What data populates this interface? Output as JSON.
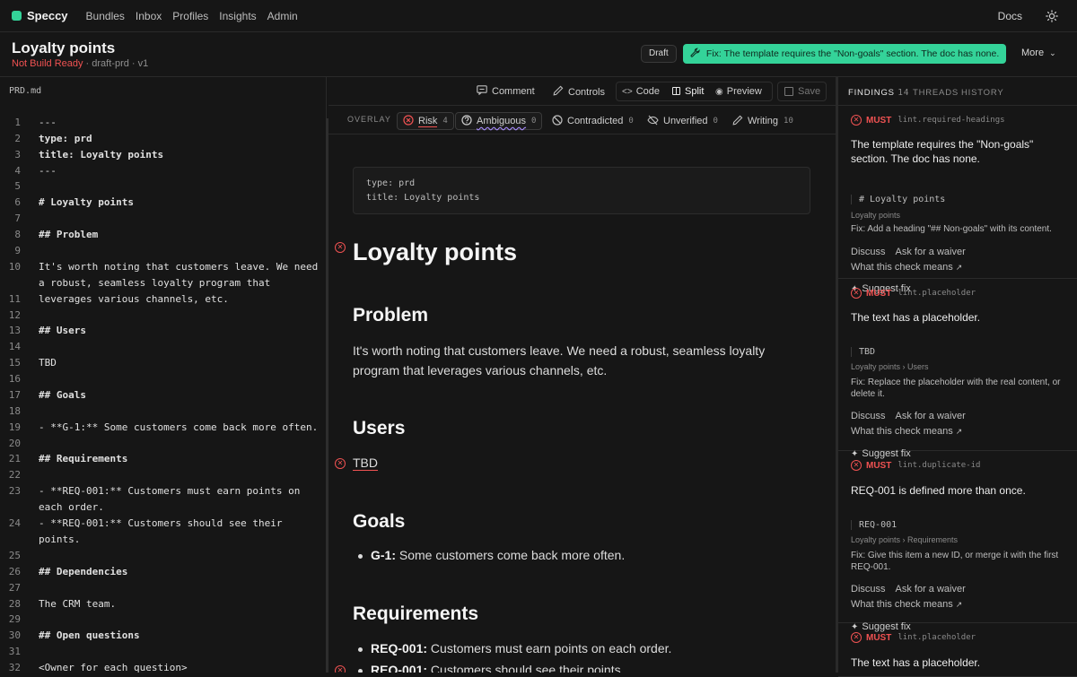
{
  "app": {
    "name": "Speccy"
  },
  "nav": [
    "Bundles",
    "Inbox",
    "Profiles",
    "Insights",
    "Admin"
  ],
  "topbar": {
    "docs": "Docs"
  },
  "doc": {
    "title": "Loyalty points",
    "status": "Not Build Ready",
    "meta": " · draft-prd · v1",
    "badge": "Draft",
    "fix_banner": "Fix: The template requires the \"Non-goals\" section. The doc has none.",
    "more": "More"
  },
  "editor": {
    "file": "PRD.md",
    "lines": [
      {
        "n": "1",
        "t": "---"
      },
      {
        "n": "2",
        "t": "type: prd"
      },
      {
        "n": "3",
        "t": "title: Loyalty points"
      },
      {
        "n": "4",
        "t": "---"
      },
      {
        "n": "5",
        "t": ""
      },
      {
        "n": "6",
        "t": "# Loyalty points"
      },
      {
        "n": "7",
        "t": ""
      },
      {
        "n": "8",
        "t": "## Problem"
      },
      {
        "n": "9",
        "t": ""
      },
      {
        "n": "10",
        "t": "It's worth noting that customers leave. We need",
        "t2": "a robust, seamless loyalty program that"
      },
      {
        "n": "11",
        "t": "leverages various channels, etc."
      },
      {
        "n": "12",
        "t": ""
      },
      {
        "n": "13",
        "t": "## Users"
      },
      {
        "n": "14",
        "t": ""
      },
      {
        "n": "15",
        "t": "TBD"
      },
      {
        "n": "16",
        "t": ""
      },
      {
        "n": "17",
        "t": "## Goals"
      },
      {
        "n": "18",
        "t": ""
      },
      {
        "n": "19",
        "t": "- **G-1:** Some customers come back more often."
      },
      {
        "n": "20",
        "t": ""
      },
      {
        "n": "21",
        "t": "## Requirements"
      },
      {
        "n": "22",
        "t": ""
      },
      {
        "n": "23",
        "t": "- **REQ-001:** Customers must earn points on",
        "t2": "each order."
      },
      {
        "n": "24",
        "t": "- **REQ-001:** Customers should see their",
        "t2": "points."
      },
      {
        "n": "25",
        "t": ""
      },
      {
        "n": "26",
        "t": "## Dependencies"
      },
      {
        "n": "27",
        "t": ""
      },
      {
        "n": "28",
        "t": "The CRM team."
      },
      {
        "n": "29",
        "t": ""
      },
      {
        "n": "30",
        "t": "## Open questions"
      },
      {
        "n": "31",
        "t": ""
      },
      {
        "n": "32",
        "t": "<Owner for each question>"
      }
    ]
  },
  "toolbar": {
    "comment": "Comment",
    "controls": "Controls",
    "code": "Code",
    "split": "Split",
    "preview": "Preview",
    "save": "Save"
  },
  "overlay": {
    "label": "OVERLAY",
    "chips": [
      {
        "label": "Risk",
        "count": "4"
      },
      {
        "label": "Ambiguous",
        "count": "0"
      },
      {
        "label": "Contradicted",
        "count": "0"
      },
      {
        "label": "Unverified",
        "count": "0"
      },
      {
        "label": "Writing",
        "count": "10"
      }
    ]
  },
  "preview": {
    "frontmatter": [
      "type: prd",
      "title: Loyalty points"
    ],
    "h1": "Loyalty points",
    "problem_h": "Problem",
    "problem_p": "It's worth noting that customers leave. We need a robust, seamless loyalty program that leverages various channels, etc.",
    "users_h": "Users",
    "users_p": "TBD",
    "goals_h": "Goals",
    "goal_1_id": "G-1:",
    "goal_1_text": " Some customers come back more often.",
    "req_h": "Requirements",
    "req_1_id": "REQ-001:",
    "req_1_text": " Customers must earn points on each order.",
    "req_2_id": "REQ-001:",
    "req_2_text": " Customers should see their points."
  },
  "findings_panel": {
    "tabs": {
      "findings": "FINDINGS",
      "findings_count": "14",
      "threads": "THREADS",
      "history": "HISTORY"
    },
    "items": [
      {
        "severity": "MUST",
        "rule": "lint.required-headings",
        "message": "The template requires the \"Non-goals\" section. The doc has none.",
        "code": "# Loyalty points",
        "path": "Loyalty points",
        "fix": "Fix: Add a heading \"## Non-goals\" with its content.",
        "discuss": "Discuss",
        "waiver": "Ask for a waiver",
        "means": "What this check means",
        "suggest": "Suggest fix"
      },
      {
        "severity": "MUST",
        "rule": "lint.placeholder",
        "message": "The text has a placeholder.",
        "code": "TBD",
        "path": "Loyalty points › Users",
        "fix": "Fix: Replace the placeholder with the real content, or delete it.",
        "discuss": "Discuss",
        "waiver": "Ask for a waiver",
        "means": "What this check means",
        "suggest": "Suggest fix"
      },
      {
        "severity": "MUST",
        "rule": "lint.duplicate-id",
        "message": "REQ-001 is defined more than once.",
        "code": "REQ-001",
        "path": "Loyalty points › Requirements",
        "fix": "Fix: Give this item a new ID, or merge it with the first REQ-001.",
        "discuss": "Discuss",
        "waiver": "Ask for a waiver",
        "means": "What this check means",
        "suggest": "Suggest fix"
      },
      {
        "severity": "MUST",
        "rule": "lint.placeholder",
        "message": "The text has a placeholder."
      }
    ]
  }
}
